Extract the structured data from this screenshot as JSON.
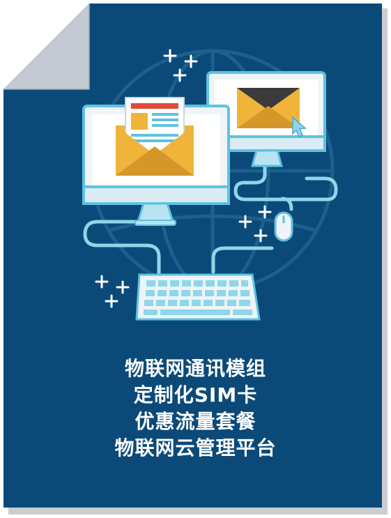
{
  "colors": {
    "page_background": "#ffffff",
    "document_fill": "#0b4a78",
    "document_shadow": "#c9ced3",
    "folded_corner": "#c3cad1",
    "screen_frame": "#eef4f7",
    "screen_border": "#5fc2de",
    "envelope": "#f0b43a",
    "envelope_dark": "#d6972a",
    "cable": "#8fd6ea",
    "caption_text": "#ffffff"
  },
  "icons": [
    "document-page-icon",
    "globe-icon",
    "monitor-icon",
    "envelope-icon",
    "newsletter-icon",
    "mouse-icon",
    "keyboard-icon",
    "cursor-icon",
    "plus-sparkle-icon"
  ],
  "caption": {
    "line1": "物联网通讯模组",
    "line2": "定制化SIM卡",
    "line3": "优惠流量套餐",
    "line4": "物联网云管理平台"
  }
}
